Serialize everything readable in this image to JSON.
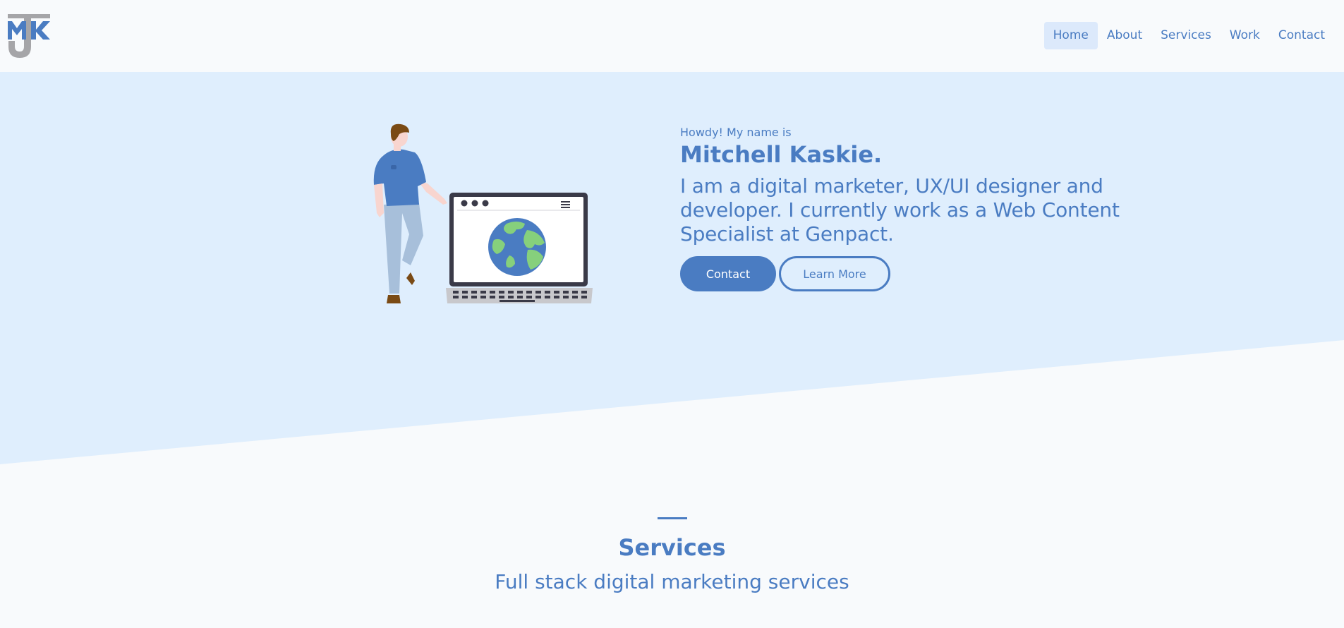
{
  "colors": {
    "accent": "#4a7cc2",
    "hero_bg": "#dfeefd",
    "page_bg": "#f8fafc",
    "logo_gray": "#a5a5a8"
  },
  "logo": {
    "text": "MJK",
    "icon": "mjk-monogram-logo"
  },
  "nav": {
    "items": [
      {
        "label": "Home",
        "active": true
      },
      {
        "label": "About",
        "active": false
      },
      {
        "label": "Services",
        "active": false
      },
      {
        "label": "Work",
        "active": false
      },
      {
        "label": "Contact",
        "active": false
      }
    ]
  },
  "hero": {
    "greeting": "Howdy! My name is",
    "name": "Mitchell Kaskie.",
    "tagline": "I am a digital marketer, UX/UI designer and developer. I currently work as a Web Content Specialist at Genpact.",
    "primary_button": "Contact",
    "secondary_button": "Learn More",
    "illustration": "man-leaning-on-laptop-with-globe"
  },
  "services": {
    "title": "Services",
    "subtitle": "Full stack digital marketing services"
  }
}
